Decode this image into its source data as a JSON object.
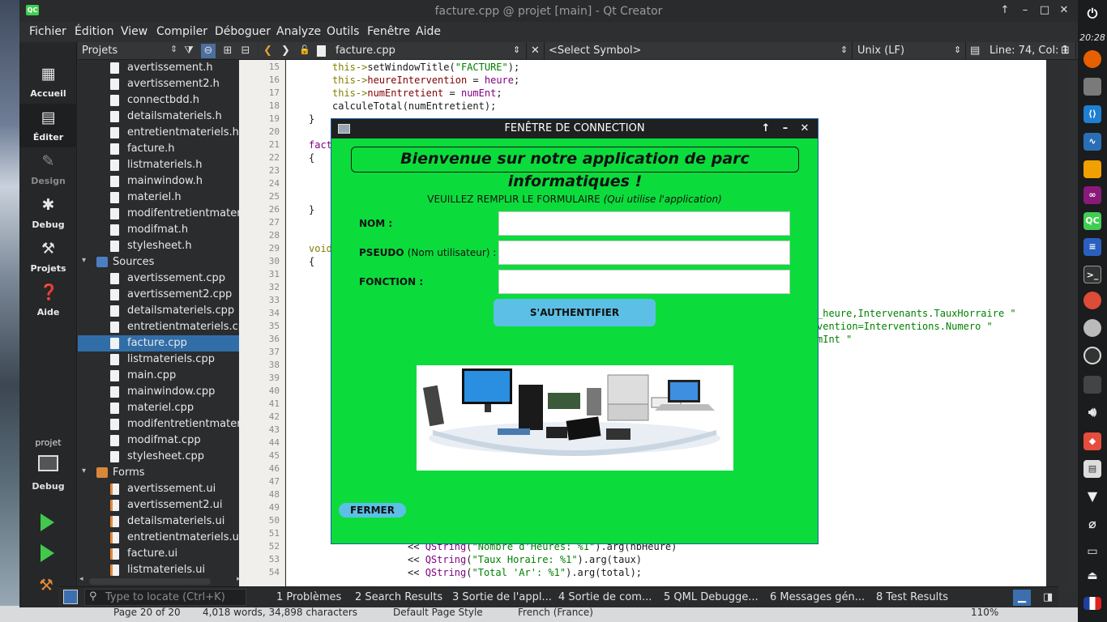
{
  "window": {
    "title": "facture.cpp @ projet [main] - Qt Creator",
    "logo": "QC"
  },
  "menu": [
    "Fichier",
    "Édition",
    "View",
    "Compiler",
    "Déboguer",
    "Analyze",
    "Outils",
    "Fenêtre",
    "Aide"
  ],
  "modes": [
    {
      "label": "Accueil",
      "icon": "grid-icon"
    },
    {
      "label": "Éditer",
      "icon": "edit-icon"
    },
    {
      "label": "Design",
      "icon": "pencil-icon"
    },
    {
      "label": "Debug",
      "icon": "bug-icon"
    },
    {
      "label": "Projets",
      "icon": "wrench-icon"
    },
    {
      "label": "Aide",
      "icon": "help-icon"
    }
  ],
  "kit": {
    "project": "projet",
    "config": "Debug"
  },
  "projects_panel": {
    "selector": "Projets",
    "headers": [
      "avertissement.h",
      "avertissement2.h",
      "connectbdd.h",
      "detailsmateriels.h",
      "entretientmateriels.h",
      "facture.h",
      "listmateriels.h",
      "mainwindow.h",
      "materiel.h",
      "modifentretientmateriel",
      "modifmat.h",
      "stylesheet.h"
    ],
    "sources_group": "Sources",
    "sources": [
      "avertissement.cpp",
      "avertissement2.cpp",
      "detailsmateriels.cpp",
      "entretientmateriels.cpp",
      "facture.cpp",
      "listmateriels.cpp",
      "main.cpp",
      "mainwindow.cpp",
      "materiel.cpp",
      "modifentretientmateriel",
      "modifmat.cpp",
      "stylesheet.cpp"
    ],
    "forms_group": "Forms",
    "forms": [
      "avertissement.ui",
      "avertissement2.ui",
      "detailsmateriels.ui",
      "entretientmateriels.ui",
      "facture.ui",
      "listmateriels.ui"
    ]
  },
  "editor": {
    "file": "facture.cpp",
    "symbol": "<Select Symbol>",
    "line_ending": "Unix (LF)",
    "position": "Line: 74, Col: 1",
    "line_numbers": [
      "15",
      "16",
      "17",
      "18",
      "19",
      "20",
      "21",
      "22",
      "23",
      "24",
      "25",
      "26",
      "27",
      "28",
      "29",
      "30",
      "31",
      "32",
      "33",
      "34",
      "35",
      "36",
      "37",
      "38",
      "39",
      "40",
      "41",
      "42",
      "43",
      "44",
      "45",
      "46",
      "47",
      "48",
      "49",
      "50",
      "51",
      "52",
      "53",
      "54"
    ],
    "code": {
      "l15a": "this->",
      "l15b": "setWindowTitle(",
      "l15c": "\"FACTURE\"",
      "l15d": ");",
      "l16a": "this->",
      "l16b": "heureIntervention",
      "l16c": " = ",
      "l16d": "heure",
      "l16e": ";",
      "l17a": "this->",
      "l17b": "numEntretient",
      "l17c": " = ",
      "l17d": "numEnt",
      "l17e": ";",
      "l18": "calculeTotal(numEntretient);",
      "l19": "}",
      "l21": "fact",
      "l22": "{",
      "l26": "}",
      "l29": "void",
      "l30": "{",
      "l34": "_heure,Intervenants.TauxHorraire \"",
      "l35": "vention=Interventions.Numero \"",
      "l36": "mInt \"",
      "l52a": "<< ",
      "l52b": "QString",
      "l52c": "(",
      "l52d": "\"Nombre d'Heures: %1\"",
      "l52e": ").arg(nbHeure)",
      "l53a": "<< ",
      "l53b": "QString",
      "l53c": "(",
      "l53d": "\"Taux Horaire: %1\"",
      "l53e": ").arg(taux)",
      "l54a": "<< ",
      "l54b": "QString",
      "l54c": "(",
      "l54d": "\"Total 'Ar': %1\"",
      "l54e": ").arg(total);"
    }
  },
  "output_tabs": [
    "1  Problèmes",
    "2  Search Results",
    "3  Sortie de l'appl...",
    "4  Sortie de com...",
    "5  QML Debugge...",
    "6  Messages gén...",
    "8  Test Results"
  ],
  "locate_placeholder": "Type to locate (Ctrl+K)",
  "statusbar": {
    "page": "Page 20 of 20",
    "words": "4,018 words, 34,898 characters",
    "style": "Default Page Style",
    "lang": "French (France)",
    "zoom": "110%"
  },
  "dock": {
    "time": "20:28"
  },
  "dialog": {
    "title": "FENÊTRE DE CONNECTION",
    "welcome": "Bienvenue sur notre application de parc informatiques !",
    "instruction": "VEUILLEZ REMPLIR LE FORMULAIRE",
    "instruction_note": "(Qui utilise l'application)",
    "nom_label": "NOM :",
    "pseudo_label": "PSEUDO",
    "pseudo_note": "(Nom utilisateur) :",
    "fonction_label": "FONCTION :",
    "auth_button": "S'AUTHENTIFIER",
    "close_button": "FERMER"
  },
  "colors": {
    "dialog_bg": "#0bdc3c",
    "button": "#5cc0e6",
    "selection": "#316ea8"
  }
}
